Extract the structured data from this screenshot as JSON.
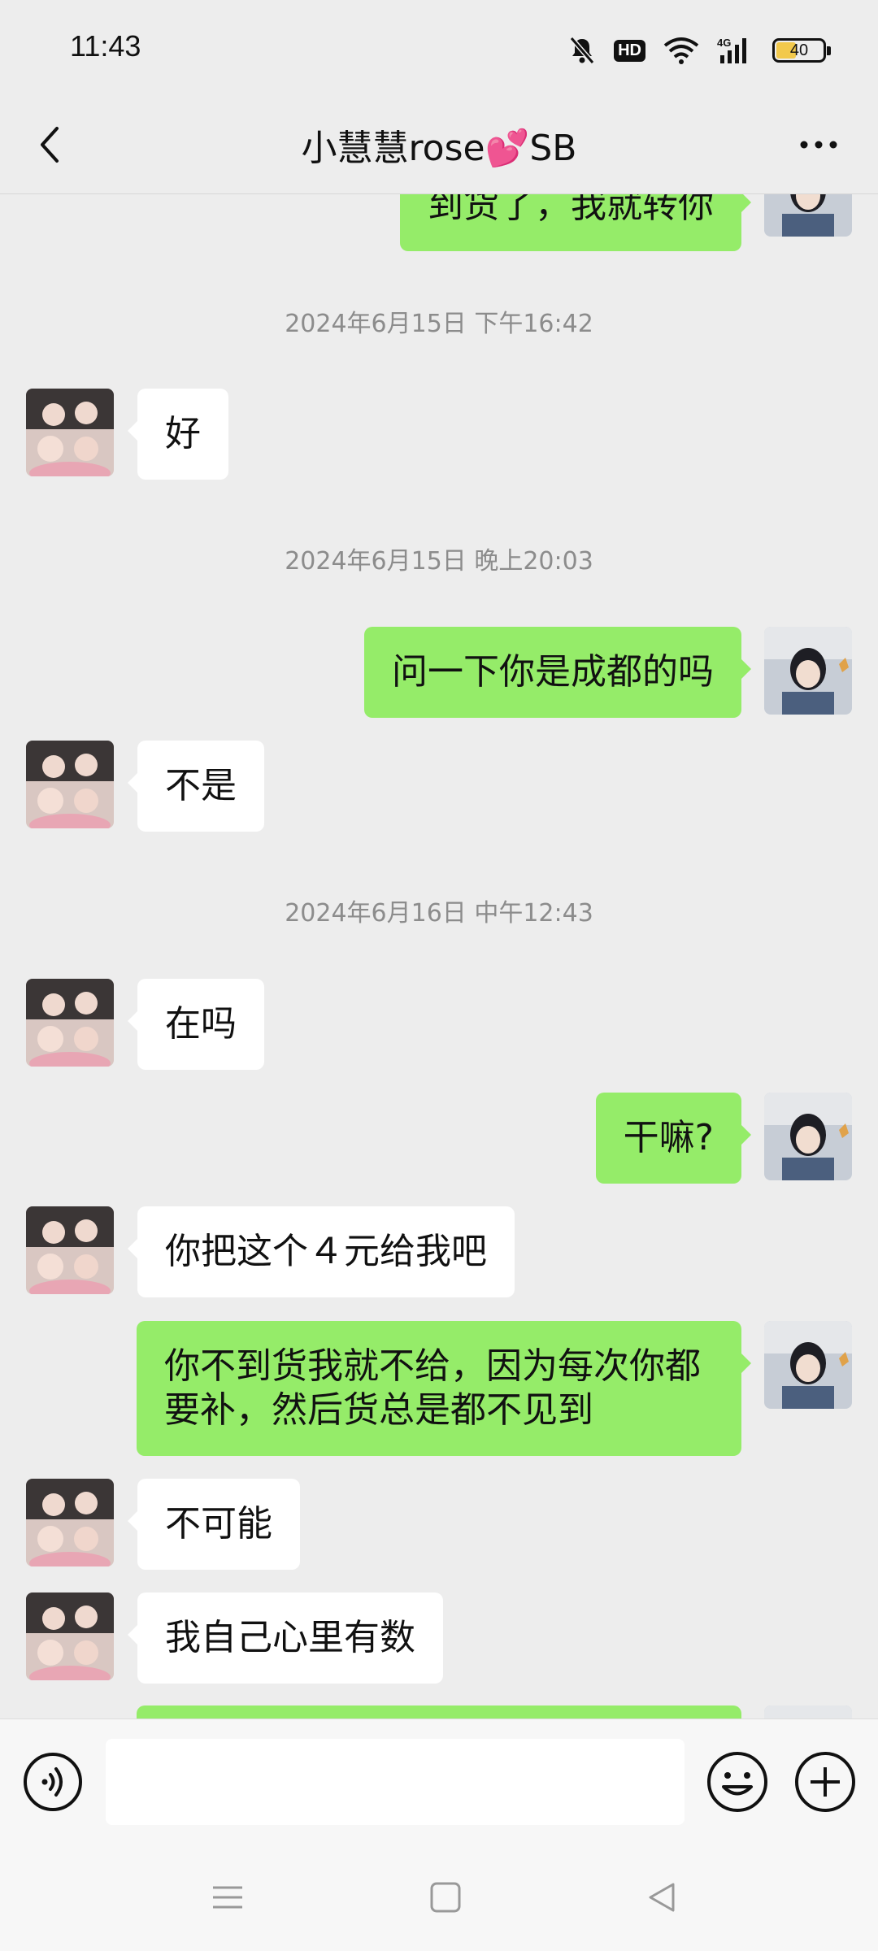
{
  "status_bar": {
    "time": "11:43",
    "network": "4G",
    "battery": "40",
    "battery_level": 0.4,
    "icons": [
      "mute-icon",
      "hd-icon",
      "wifi-icon",
      "signal-icon",
      "battery-icon"
    ]
  },
  "header": {
    "title": "小慧慧rose💕SB",
    "back_icon": "chevron-left-icon",
    "more_icon": "more-dots-icon"
  },
  "chat": {
    "messages": [
      {
        "side": "right",
        "text": "到货了，我就转你"
      },
      {
        "type": "time",
        "text": "2024年6月15日 下午16:42"
      },
      {
        "side": "left",
        "text": "好"
      },
      {
        "type": "time",
        "text": "2024年6月15日 晚上20:03"
      },
      {
        "side": "right",
        "text": "问一下你是成都的吗"
      },
      {
        "side": "left",
        "text": "不是"
      },
      {
        "type": "time",
        "text": "2024年6月16日 中午12:43"
      },
      {
        "side": "left",
        "text": "在吗"
      },
      {
        "side": "right",
        "text": "干嘛?"
      },
      {
        "side": "left",
        "text": "你把这个４元给我吧"
      },
      {
        "side": "right",
        "text": "你不到货我就不给，因为每次你都要补，然后货总是都不见到"
      },
      {
        "side": "left",
        "text": "不可能"
      },
      {
        "side": "left",
        "text": "我自己心里有数"
      }
    ]
  },
  "input_bar": {
    "input_value": "",
    "voice_icon": "voice-icon",
    "emoji_icon": "emoji-icon",
    "plus_icon": "plus-icon"
  },
  "nav_bar": {
    "icons": [
      "menu-icon",
      "home-icon",
      "back-triangle-icon"
    ]
  },
  "colors": {
    "background": "#ededed",
    "own_bubble": "#95ec69",
    "other_bubble": "#ffffff",
    "timestamp_text": "#8c8c8c"
  }
}
